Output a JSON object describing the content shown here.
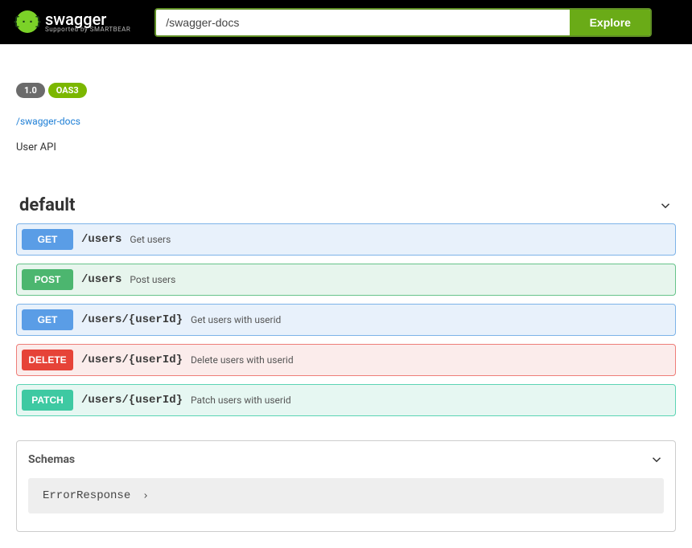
{
  "topbar": {
    "logo_text": "swagger",
    "logo_supported_by": "Supported by SMARTBEAR",
    "search_value": "/swagger-docs",
    "explore_label": "Explore"
  },
  "info": {
    "version_badge": "1.0",
    "oas_badge": "OAS3",
    "docs_link": "/swagger-docs",
    "description": "User API"
  },
  "tag": {
    "name": "default"
  },
  "operations": [
    {
      "method": "GET",
      "method_class": "get",
      "path": "/users",
      "summary": "Get users"
    },
    {
      "method": "POST",
      "method_class": "post",
      "path": "/users",
      "summary": "Post users"
    },
    {
      "method": "GET",
      "method_class": "get",
      "path": "/users/{userId}",
      "summary": "Get users with userid"
    },
    {
      "method": "DELETE",
      "method_class": "delete",
      "path": "/users/{userId}",
      "summary": "Delete users with userid"
    },
    {
      "method": "PATCH",
      "method_class": "patch",
      "path": "/users/{userId}",
      "summary": "Patch users with userid"
    }
  ],
  "schemas": {
    "title": "Schemas",
    "items": [
      {
        "name": "ErrorResponse"
      }
    ]
  }
}
